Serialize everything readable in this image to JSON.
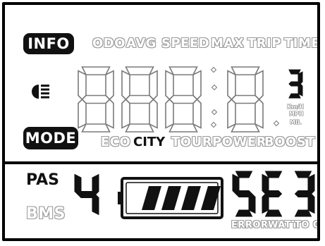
{
  "labels": {
    "info": "INFO",
    "mode": "MODE",
    "top_row": [
      "ODO",
      "AVG",
      "SPEED",
      "MAX",
      "TRIP",
      "TIME"
    ],
    "modes": [
      "ECO",
      "CITY",
      "TOUR",
      "POWER",
      "BOOST"
    ],
    "active_mode": "CITY",
    "units": [
      "Km/H",
      "MPH",
      "MIL"
    ],
    "pas": "PAS",
    "bms": "BMS",
    "bottom_right": [
      "ERROR",
      "WATT",
      "TO GO"
    ]
  },
  "display": {
    "main_digits": [
      "8",
      "8",
      "8",
      "8"
    ],
    "small_digit": "3",
    "pas_level": "4",
    "right_digits": [
      "5",
      "E",
      "3"
    ],
    "battery_bars": 4
  },
  "colors": {
    "ink": "#111111",
    "dim_outline": "#9a9a9a",
    "background": "#ffffff"
  },
  "icons": [
    "headlight-icon",
    "battery-icon"
  ]
}
